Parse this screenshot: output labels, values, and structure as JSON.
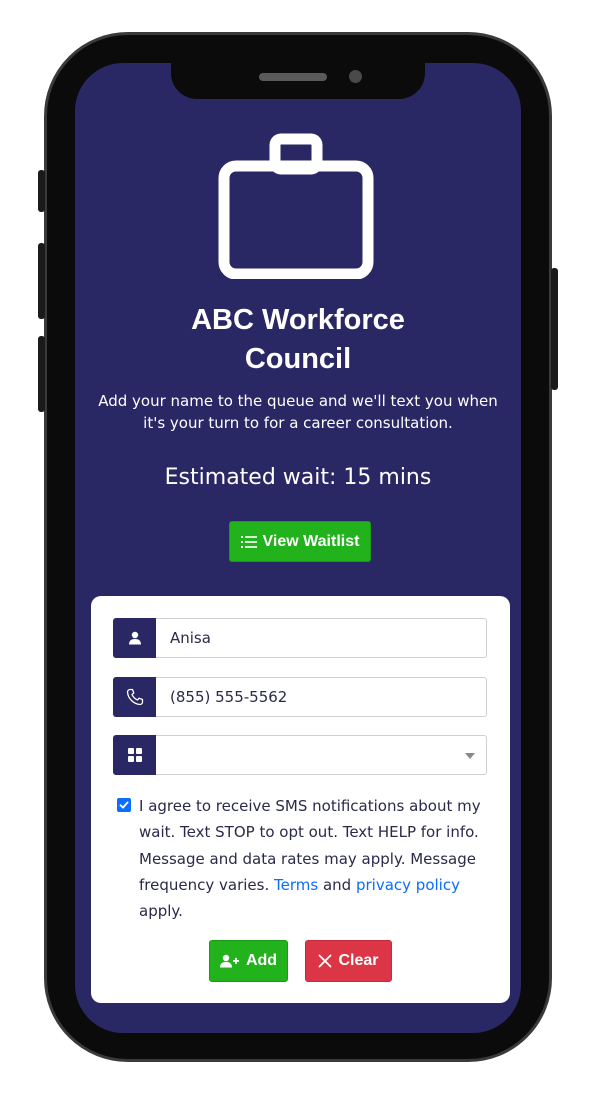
{
  "header": {
    "icon": "briefcase-icon",
    "title_line1": "ABC Workforce",
    "title_line2": "Council",
    "subtitle": "Add your name to the queue and we'll text you when it's your turn to for a career consultation.",
    "estimated_wait": "Estimated wait: 15 mins"
  },
  "view_waitlist": {
    "label": "View Waitlist",
    "icon": "list-icon"
  },
  "form": {
    "name": {
      "icon": "user-icon",
      "value": "Anisa"
    },
    "phone": {
      "icon": "phone-icon",
      "value": "(855) 555-5562"
    },
    "service": {
      "icon": "grid-icon",
      "value": ""
    },
    "consent": {
      "checked": true,
      "text_before": "I agree to receive SMS notifications about my wait. Text STOP to opt out. Text HELP for info. Message and data rates may apply. Message frequency varies.",
      "terms_link": "Terms",
      "and": "and",
      "privacy_link": "privacy policy",
      "text_after": "apply."
    },
    "add_button": {
      "label": "Add",
      "icon": "user-plus-icon"
    },
    "clear_button": {
      "label": "Clear",
      "icon": "close-icon"
    }
  },
  "colors": {
    "screen_bg": "#2a2765",
    "green": "#22b31c",
    "red": "#dc3545",
    "link": "#0b6efd"
  }
}
